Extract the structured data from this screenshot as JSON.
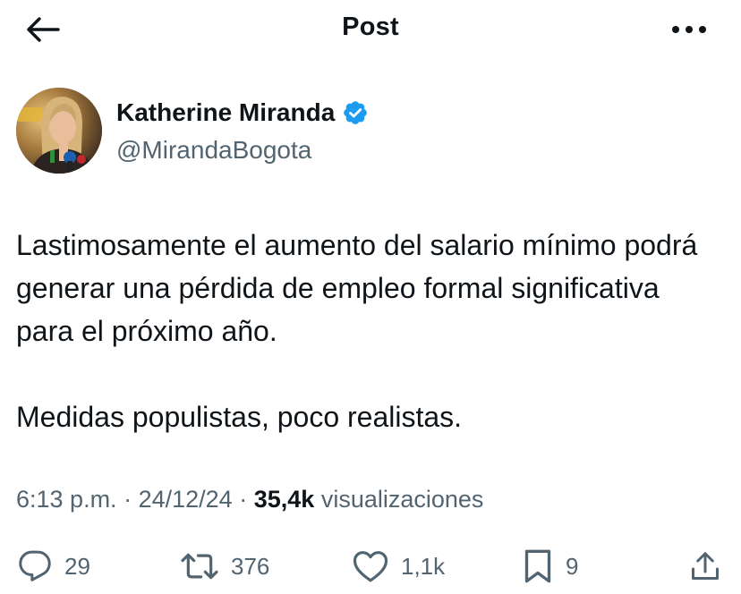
{
  "header": {
    "title": "Post",
    "back_icon": "arrow-left-icon",
    "more_icon": "more-horizontal-icon"
  },
  "author": {
    "name": "Katherine Miranda",
    "handle": "@MirandaBogota",
    "verified_color": "#1d9bf0"
  },
  "tweet": {
    "paragraphs": [
      "Lastimosamente el aumento del salario mínimo podrá generar una pérdida de empleo formal significativa para el próximo año.",
      "Medidas populistas, poco realistas."
    ]
  },
  "meta": {
    "time": "6:13 p.m.",
    "separator": "·",
    "date": "24/12/24",
    "views_count": "35,4k",
    "views_label": "visualizaciones"
  },
  "actions": {
    "replies": "29",
    "reposts": "376",
    "likes": "1,1k",
    "bookmarks": "9"
  },
  "colors": {
    "text": "#0f1419",
    "secondary": "#536471",
    "accent": "#1d9bf0"
  }
}
